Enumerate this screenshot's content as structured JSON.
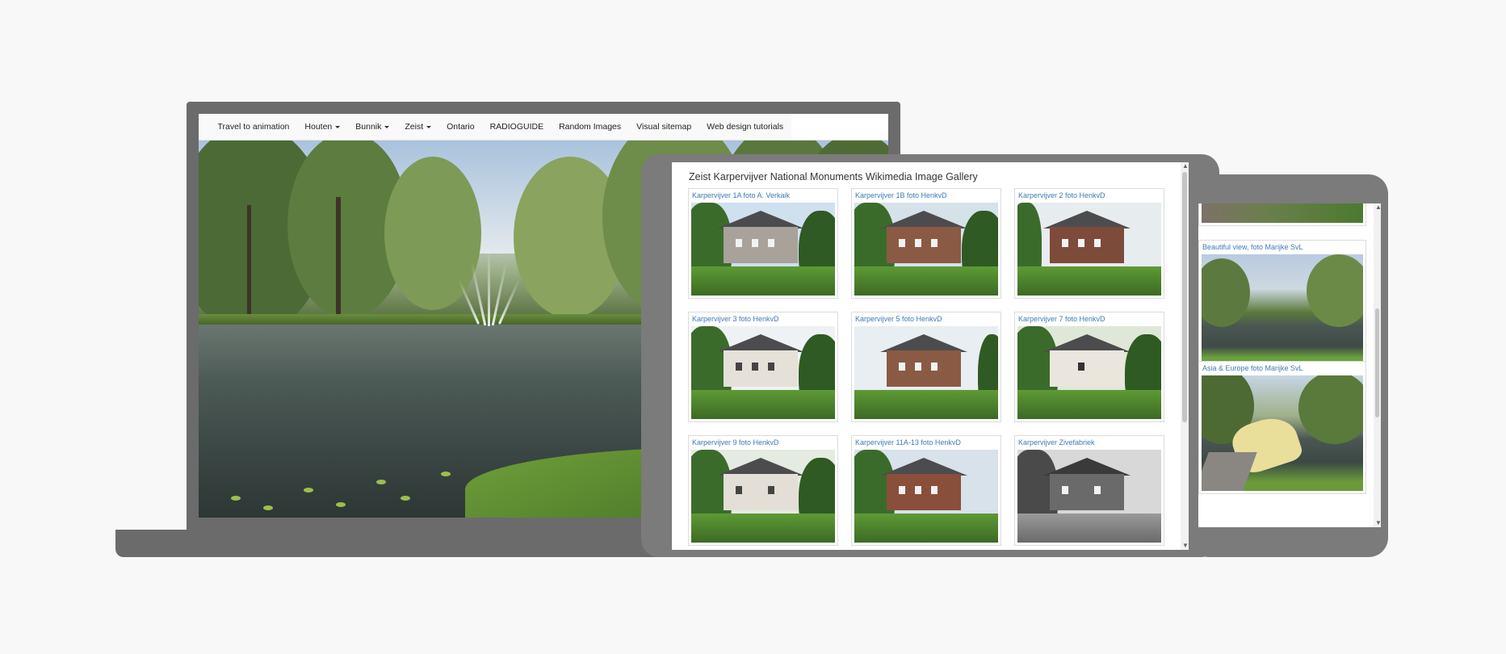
{
  "laptop": {
    "nav": [
      {
        "label": "Travel to animation",
        "dropdown": false
      },
      {
        "label": "Houten",
        "dropdown": true
      },
      {
        "label": "Bunnik",
        "dropdown": true
      },
      {
        "label": "Zeist",
        "dropdown": true
      },
      {
        "label": "Ontario",
        "dropdown": false
      },
      {
        "label": "RADIOGUIDE",
        "dropdown": false
      },
      {
        "label": "Random Images",
        "dropdown": false
      },
      {
        "label": "Visual sitemap",
        "dropdown": false
      },
      {
        "label": "Web design tutorials",
        "dropdown": false
      }
    ]
  },
  "tablet": {
    "title": "Zeist Karpervijver National Monuments Wikimedia Image Gallery",
    "cards": [
      {
        "title": "Karpervijver 1A foto A. Verkaik"
      },
      {
        "title": "Karpervijver 1B foto HenkvD"
      },
      {
        "title": "Karpervijver 2 foto HenkvD"
      },
      {
        "title": "Karpervijver 3 foto HenkvD"
      },
      {
        "title": "Karpervijver 5 foto HenkvD"
      },
      {
        "title": "Karpervijver 7 foto HenkvD"
      },
      {
        "title": "Karpervijver 9 foto HenkvD"
      },
      {
        "title": "Karpervijver 11A-13 foto HenkvD"
      },
      {
        "title": "Karpervijver Zivefabriek"
      }
    ]
  },
  "phone": {
    "cards": [
      {
        "title": "Beautiful view, foto Marijke SvL"
      },
      {
        "title": "Asia & Europe foto Marijke SvL"
      }
    ]
  },
  "colors": {
    "frame": "#6b6b6b",
    "link": "#3f7ab3",
    "background": "#f8f8f8"
  },
  "icons": {
    "dropdown": "caret-down-icon",
    "scroll_up": "scroll-up-arrow-icon",
    "scroll_down": "scroll-down-arrow-icon"
  }
}
